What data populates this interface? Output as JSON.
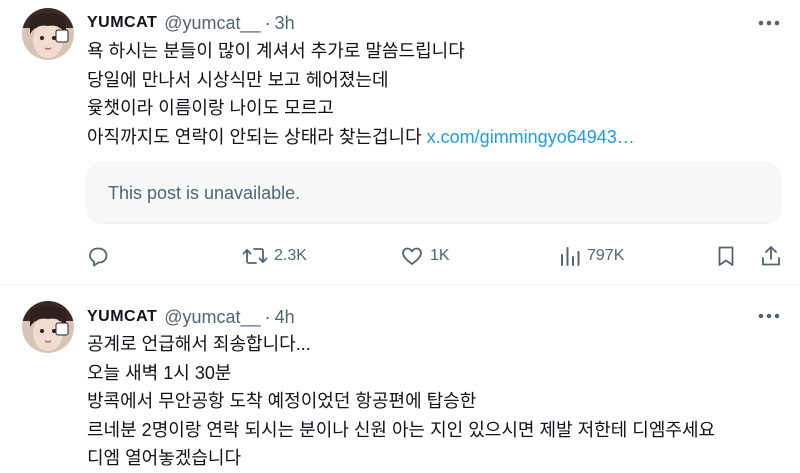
{
  "tweets": [
    {
      "author_name": "YUMCAT",
      "handle": "@yumcat__",
      "separator": "·",
      "time": "3h",
      "lines": [
        "욕 하시는 분들이 많이 계셔서 추가로 말씀드립니다",
        "당일에 만나서 시상식만 보고 헤어졌는데",
        "윷챗이라 이름이랑 나이도 모르고",
        "아직까지도 연락이 안되는 상태라 찾는겁니다"
      ],
      "link_text": "x.com/gimmingyo64943…",
      "quote_text": "This post is unavailable.",
      "replies": "",
      "retweets": "2.3K",
      "likes": "1K",
      "views": "797K"
    },
    {
      "author_name": "YUMCAT",
      "handle": "@yumcat__",
      "separator": "·",
      "time": "4h",
      "lines": [
        "공계로 언급해서 죄송합니다...",
        "오늘 새벽 1시 30분",
        "방콕에서 무안공항 도착 예정이었던 항공편에 탑승한",
        "르네분 2명이랑 연락 되시는 분이나 신원 아는 지인 있으시면 제발 저한테 디엠주세요",
        "디엠 열어놓겠습니다"
      ]
    }
  ],
  "icons": {
    "more": "more-horizontal-icon",
    "reply": "reply-bubble-icon",
    "retweet": "retweet-icon",
    "like": "heart-icon",
    "views": "views-bar-chart-icon",
    "bookmark": "bookmark-icon",
    "share": "share-upload-icon"
  },
  "colors": {
    "text": "#0f1419",
    "secondary": "#536471",
    "link": "#1d9bf0",
    "quote_bg": "#f7f9f9",
    "divider": "#eff3f4"
  }
}
